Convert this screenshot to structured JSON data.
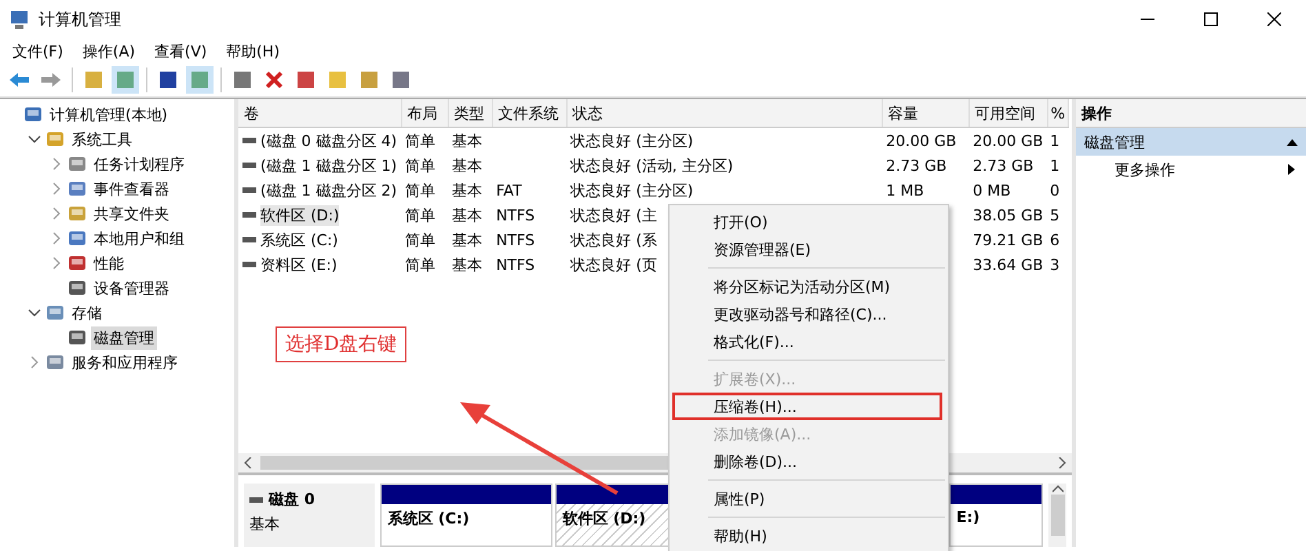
{
  "window": {
    "title": "计算机管理"
  },
  "menu_bar": [
    "文件(F)",
    "操作(A)",
    "查看(V)",
    "帮助(H)"
  ],
  "tree": [
    {
      "label": "计算机管理(本地)",
      "selected": false,
      "children": [
        {
          "label": "系统工具",
          "expanded": true,
          "selected": false,
          "children": [
            {
              "label": "任务计划程序",
              "expanded": false,
              "selected": false
            },
            {
              "label": "事件查看器",
              "expanded": false,
              "selected": false
            },
            {
              "label": "共享文件夹",
              "expanded": false,
              "selected": false
            },
            {
              "label": "本地用户和组",
              "expanded": false,
              "selected": false
            },
            {
              "label": "性能",
              "expanded": false,
              "selected": false
            },
            {
              "label": "设备管理器",
              "selected": false
            }
          ]
        },
        {
          "label": "存储",
          "expanded": true,
          "selected": false,
          "children": [
            {
              "label": "磁盘管理",
              "selected": true
            }
          ]
        },
        {
          "label": "服务和应用程序",
          "expanded": false,
          "selected": false
        }
      ]
    }
  ],
  "table": {
    "columns": [
      "卷",
      "布局",
      "类型",
      "文件系统",
      "状态",
      "容量",
      "可用空间",
      "%"
    ],
    "rows": [
      {
        "cells": [
          "(磁盘 0 磁盘分区 4)",
          "简单",
          "基本",
          "",
          "状态良好 (主分区)",
          "20.00 GB",
          "20.00 GB",
          "1"
        ],
        "selected": false
      },
      {
        "cells": [
          "(磁盘 1 磁盘分区 1)",
          "简单",
          "基本",
          "",
          "状态良好 (活动, 主分区)",
          "2.73 GB",
          "2.73 GB",
          "1"
        ],
        "selected": false
      },
      {
        "cells": [
          "(磁盘 1 磁盘分区 2)",
          "简单",
          "基本",
          "FAT",
          "状态良好 (主分区)",
          "1 MB",
          "0 MB",
          "0"
        ],
        "selected": false
      },
      {
        "cells": [
          "软件区 (D:)",
          "简单",
          "基本",
          "NTFS",
          "状态良好 (主",
          "",
          "38.05 GB",
          "5"
        ],
        "selected": true
      },
      {
        "cells": [
          "系统区 (C:)",
          "简单",
          "基本",
          "NTFS",
          "状态良好 (系",
          "",
          "79.21 GB",
          "6"
        ],
        "selected": false
      },
      {
        "cells": [
          "资料区 (E:)",
          "简单",
          "基本",
          "NTFS",
          "状态良好 (页",
          "",
          "33.64 GB",
          "3"
        ],
        "selected": false
      }
    ]
  },
  "disk_map": {
    "name": "磁盘 0",
    "type": "基本",
    "partitions": [
      {
        "label": "系统区  (C:)",
        "selected": false
      },
      {
        "label": "软件区  (D:)",
        "selected": true
      },
      {
        "label": "E:)",
        "selected": false
      }
    ]
  },
  "actions": {
    "title": "操作",
    "section": "磁盘管理",
    "items": [
      "更多操作"
    ]
  },
  "context_menu": [
    {
      "kind": "item",
      "label": "打开(O)",
      "disabled": false,
      "highlighted": false
    },
    {
      "kind": "item",
      "label": "资源管理器(E)",
      "disabled": false,
      "highlighted": false
    },
    {
      "kind": "separator"
    },
    {
      "kind": "item",
      "label": "将分区标记为活动分区(M)",
      "disabled": false,
      "highlighted": false
    },
    {
      "kind": "item",
      "label": "更改驱动器号和路径(C)...",
      "disabled": false,
      "highlighted": false
    },
    {
      "kind": "item",
      "label": "格式化(F)...",
      "disabled": false,
      "highlighted": false
    },
    {
      "kind": "separator"
    },
    {
      "kind": "item",
      "label": "扩展卷(X)...",
      "disabled": true,
      "highlighted": false
    },
    {
      "kind": "item",
      "label": "压缩卷(H)...",
      "disabled": false,
      "highlighted": true
    },
    {
      "kind": "item",
      "label": "添加镜像(A)...",
      "disabled": true,
      "highlighted": false
    },
    {
      "kind": "item",
      "label": "删除卷(D)...",
      "disabled": false,
      "highlighted": false
    },
    {
      "kind": "separator"
    },
    {
      "kind": "item",
      "label": "属性(P)",
      "disabled": false,
      "highlighted": false
    },
    {
      "kind": "separator"
    },
    {
      "kind": "item",
      "label": "帮助(H)",
      "disabled": false,
      "highlighted": false
    }
  ],
  "annotation": {
    "text": "选择D盘右键"
  }
}
